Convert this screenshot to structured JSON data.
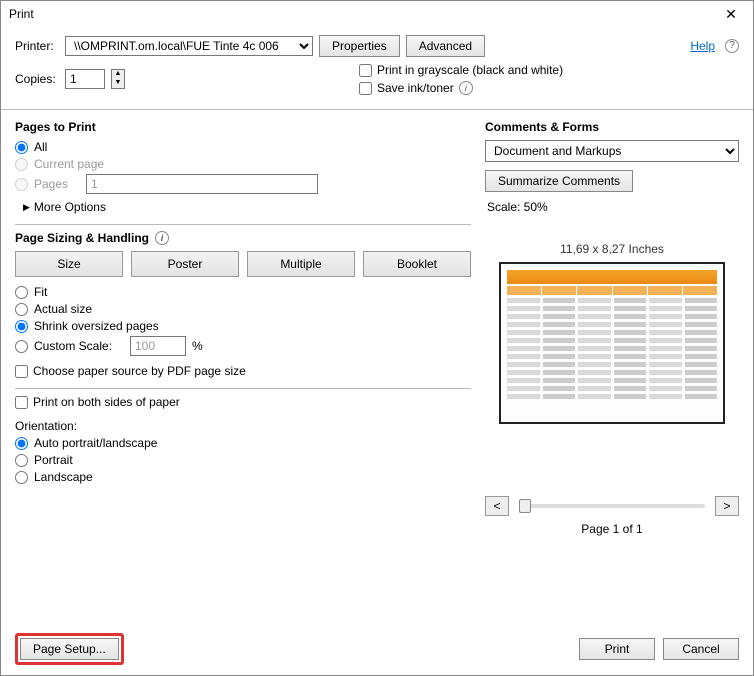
{
  "window": {
    "title": "Print"
  },
  "top": {
    "printer_label": "Printer:",
    "printer_value": "\\\\OMPRINT.om.local\\FUE Tinte 4c 006",
    "properties_btn": "Properties",
    "advanced_btn": "Advanced",
    "help_link": "Help",
    "copies_label": "Copies:",
    "copies_value": "1",
    "grayscale_label": "Print in grayscale (black and white)",
    "saveink_label": "Save ink/toner"
  },
  "pages": {
    "title": "Pages to Print",
    "all": "All",
    "current": "Current page",
    "pages_label": "Pages",
    "pages_value": "1",
    "more_options": "More Options"
  },
  "sizing": {
    "title": "Page Sizing & Handling",
    "size": "Size",
    "poster": "Poster",
    "multiple": "Multiple",
    "booklet": "Booklet",
    "fit": "Fit",
    "actual": "Actual size",
    "shrink": "Shrink oversized pages",
    "custom": "Custom Scale:",
    "custom_value": "100",
    "percent": "%",
    "choose_paper": "Choose paper source by PDF page size"
  },
  "duplex": {
    "both_sides": "Print on both sides of paper"
  },
  "orient": {
    "title": "Orientation:",
    "auto": "Auto portrait/landscape",
    "portrait": "Portrait",
    "landscape": "Landscape"
  },
  "comments": {
    "title": "Comments & Forms",
    "dropdown": "Document and Markups",
    "summarize": "Summarize Comments"
  },
  "preview": {
    "scale_label": "Scale:  50%",
    "dimensions": "11,69 x 8,27 Inches",
    "prev": "<",
    "next": ">",
    "page_of": "Page 1 of 1"
  },
  "footer": {
    "page_setup": "Page Setup...",
    "print": "Print",
    "cancel": "Cancel"
  }
}
